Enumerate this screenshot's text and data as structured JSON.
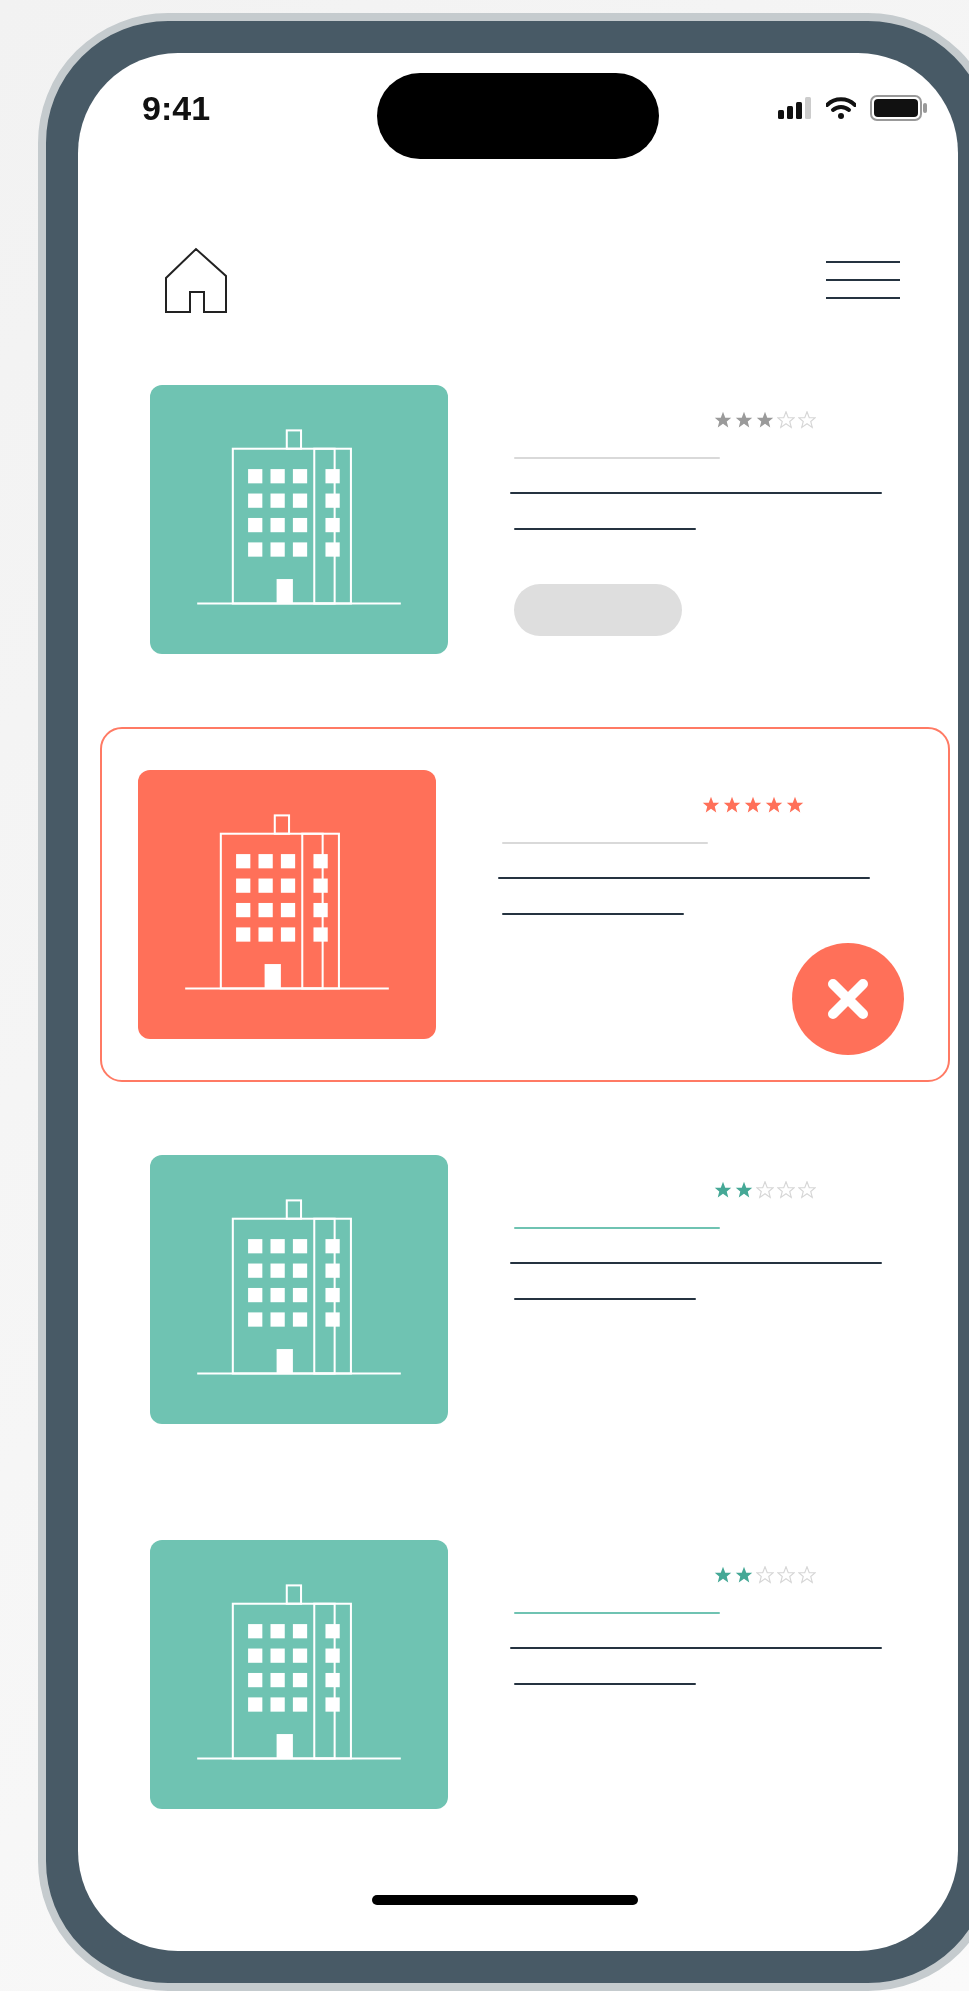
{
  "status_bar": {
    "time": "9:41"
  },
  "cards": [
    {
      "kind": "muted",
      "selected": false,
      "color": "#6fc3b2",
      "stars": 3
    },
    {
      "kind": "plain",
      "selected": true,
      "color": "#ff7059",
      "stars": 5
    },
    {
      "kind": "normal",
      "selected": false,
      "color": "#6fc3b2",
      "stars": 2
    },
    {
      "kind": "normal",
      "selected": false,
      "color": "#6fc3b2",
      "stars": 2
    }
  ]
}
